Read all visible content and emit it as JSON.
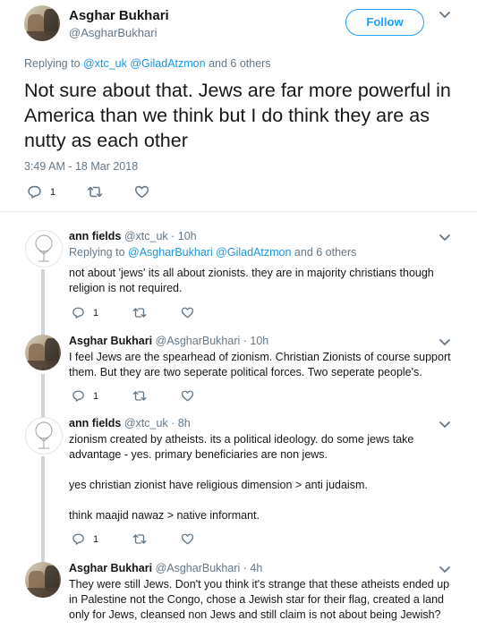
{
  "main_tweet": {
    "name": "Asghar Bukhari",
    "handle": "@AsgharBukhari",
    "follow_label": "Follow",
    "replying_prefix": "Replying to",
    "replying_to": "@xtc_uk @GiladAtzmon",
    "replying_suffix": "and 6 others",
    "text": "Not sure about that. Jews are far more powerful in America than we think but I do think they are as nutty as each other",
    "timestamp": "3:49 AM - 18 Mar 2018",
    "reply_count": "1"
  },
  "replies": [
    {
      "name": "ann fields",
      "meta": "@xtc_uk · 10h",
      "replying_prefix": "Replying to",
      "replying_to": "@AsgharBukhari @GiladAtzmon",
      "replying_suffix": "and 6 others",
      "text": "not about 'jews' its all about zionists. they are in majority christians though religion is not required.",
      "reply_count": "1"
    },
    {
      "name": "Asghar Bukhari",
      "meta": "@AsgharBukhari · 10h",
      "text": "I feel Jews are the spearhead of zionism. Christian Zionists of course support them. But they are two seperate political forces. Two seperate people's.",
      "reply_count": "1"
    },
    {
      "name": "ann fields",
      "meta": "@xtc_uk · 8h",
      "text": "zionism created by atheists. its a political ideology. do some jews take advantage - yes. primary beneficiaries are non jews.",
      "text2": "yes christian zionist have religious  dimension > anti judaism.",
      "text3": "think maajid nawaz > native informant.",
      "reply_count": "1"
    },
    {
      "name": "Asghar Bukhari",
      "meta": "@AsgharBukhari · 4h",
      "text": "They were still Jews. Don't you think it's strange that these atheists ended up in Palestine not the Congo, chose a Jewish star for their flag, created a land only for Jews, cleansed non Jews and still claim is not about being Jewish?"
    }
  ],
  "icons": [
    "reply-icon",
    "retweet-icon",
    "like-icon",
    "chevron-down-icon"
  ],
  "colors": {
    "link": "#1b95e0",
    "accent": "#1da1f2",
    "muted": "#657786",
    "thread_line": "#ccd6dd"
  }
}
